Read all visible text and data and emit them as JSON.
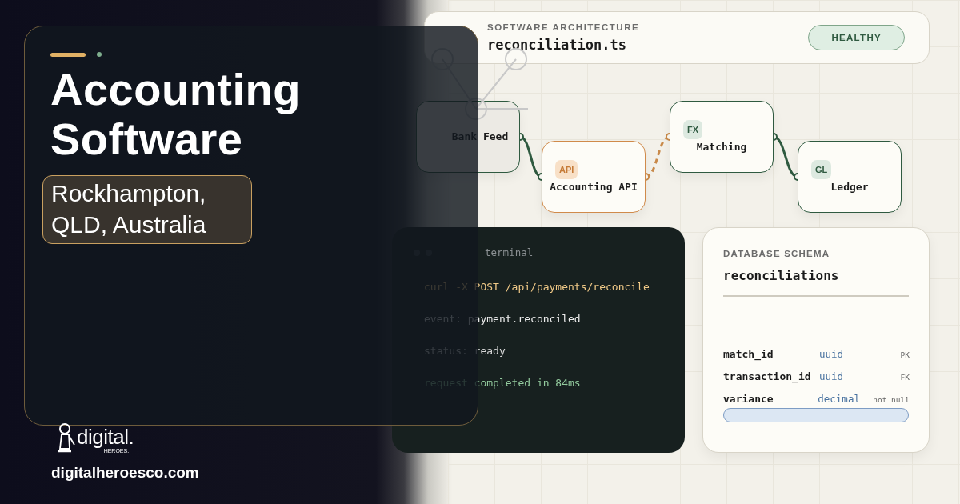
{
  "hero": {
    "title": "Accounting Software",
    "location": "Rockhampton, QLD, Australia"
  },
  "brand": {
    "logo_word": "digital.",
    "logo_sub": "HEROES.",
    "url": "digitalheroesco.com"
  },
  "architecture": {
    "label": "SOFTWARE ARCHITECTURE",
    "file": "reconciliation.ts",
    "status": "HEALTHY"
  },
  "nodes": [
    {
      "name": "Bank Feed",
      "kind": "neutral"
    },
    {
      "badge": "API",
      "name": "Accounting API",
      "kind": "api"
    },
    {
      "badge": "FX",
      "name": "Matching",
      "kind": "process"
    },
    {
      "badge": "GL",
      "name": "Ledger",
      "kind": "process"
    }
  ],
  "edges": [
    {
      "kind": "solid"
    },
    {
      "kind": "dashed"
    },
    {
      "kind": "solid"
    }
  ],
  "terminal": {
    "title": "terminal",
    "lines": [
      {
        "text": "curl -X POST /api/payments/reconcile",
        "kind": "command"
      },
      {
        "text": "event: payment.reconciled",
        "kind": "event"
      },
      {
        "text": "status: ready",
        "kind": "status"
      },
      {
        "text": "request completed in 84ms",
        "kind": "success"
      }
    ]
  },
  "schema": {
    "label": "DATABASE SCHEMA",
    "table": "reconciliations",
    "fields": [
      {
        "name": "match_id",
        "type": "uuid",
        "constraint": "PK"
      },
      {
        "name": "transaction_id",
        "type": "uuid",
        "constraint": "FK"
      },
      {
        "name": "variance",
        "type": "decimal",
        "constraint": "not null"
      }
    ]
  }
}
